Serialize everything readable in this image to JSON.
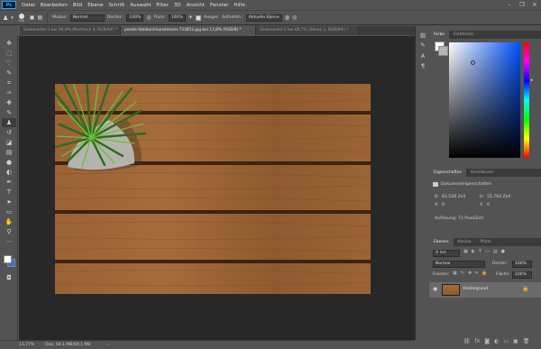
{
  "menu": {
    "logo": "Ps",
    "items": [
      "Datei",
      "Bearbeiten",
      "Bild",
      "Ebene",
      "Schrift",
      "Auswahl",
      "Filter",
      "3D",
      "Ansicht",
      "Fenster",
      "Hilfe"
    ],
    "window_controls": [
      "–",
      "❐",
      "✕"
    ]
  },
  "options": {
    "brush_size": "250",
    "modus_label": "Modus:",
    "modus_value": "Normal",
    "deckkraft_label": "Deckkr.:",
    "deckkraft_value": "100%",
    "fluss_label": "Fluss:",
    "fluss_value": "100%",
    "ausger_label": "Ausger.",
    "aufnehmen_label": "Aufnehm.:",
    "aufnehmen_value": "Aktuelle Ebene"
  },
  "tabs": [
    {
      "label": "Slidemaster-1 bei 90,9% (Rechteck 4, RGB/8#) *",
      "active": false
    },
    {
      "label": "pexels-fotobord-kunstenom-733853.jpg bei 13,8% (RGB/8) *",
      "active": true
    },
    {
      "label": "Slidemaster-2 bei 66,7% (Ebene 1, RGB/8#) *",
      "active": false
    }
  ],
  "toolbar_tools": [
    {
      "name": "move-tool",
      "glyph": "✥"
    },
    {
      "name": "marquee-tool",
      "glyph": "⬚"
    },
    {
      "name": "lasso-tool",
      "glyph": "➰"
    },
    {
      "name": "quick-select-tool",
      "glyph": "✎"
    },
    {
      "name": "crop-tool",
      "glyph": "⌗"
    },
    {
      "name": "eyedropper-tool",
      "glyph": "✑"
    },
    {
      "name": "healing-tool",
      "glyph": "✚"
    },
    {
      "name": "brush-tool",
      "glyph": "✎"
    },
    {
      "name": "stamp-tool",
      "glyph": "♟"
    },
    {
      "name": "history-brush-tool",
      "glyph": "↺"
    },
    {
      "name": "eraser-tool",
      "glyph": "◪"
    },
    {
      "name": "gradient-tool",
      "glyph": "▤"
    },
    {
      "name": "blur-tool",
      "glyph": "●"
    },
    {
      "name": "dodge-tool",
      "glyph": "◐"
    },
    {
      "name": "pen-tool",
      "glyph": "✒"
    },
    {
      "name": "type-tool",
      "glyph": "T"
    },
    {
      "name": "path-select-tool",
      "glyph": "➤"
    },
    {
      "name": "shape-tool",
      "glyph": "▭"
    },
    {
      "name": "hand-tool",
      "glyph": "✋"
    },
    {
      "name": "zoom-tool",
      "glyph": "⚲"
    },
    {
      "name": "more-tools",
      "glyph": "⋯"
    }
  ],
  "status": {
    "zoom": "13,77%",
    "doc": "Dok: 69,1 MB/69,1 MB"
  },
  "color_panel": {
    "tabs": [
      "Farbe",
      "Farbfelder"
    ],
    "hue_color": "#0051ff"
  },
  "properties_panel": {
    "tabs": [
      "Eigenschaften",
      "Korrekturen"
    ],
    "section_title": "Dokumenteigenschaften",
    "b_label": "B:",
    "b_value": "83,528 Zoll",
    "h_label": "H:",
    "h_value": "55,764 Zoll",
    "x_label": "X:",
    "x_value": "0",
    "y_label": "Y:",
    "y_value": "0",
    "resolution": "Auflösung: 72 Pixel/Zoll"
  },
  "layers_panel": {
    "tabs": [
      "Ebenen",
      "Kanäle",
      "Pfade"
    ],
    "filter_label": "Art",
    "blend_mode": "Normal",
    "opacity_label": "Deckkr.:",
    "opacity_value": "100%",
    "lock_label": "Fixieren:",
    "fill_label": "Fläche:",
    "fill_value": "100%",
    "layer_name": "Hintergrund"
  }
}
